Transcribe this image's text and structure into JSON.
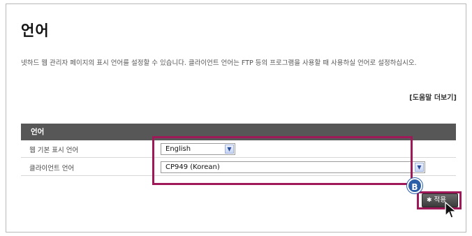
{
  "page": {
    "title": "언어",
    "description": "넷하드 웹 관리자 페이지의 표시 언어를 설정할 수 있습니다. 클라이언트 언어는 FTP 등의 프로그램을 사용할 때 사용하실 언어로 설정하십시오.",
    "help_link": "[도움말 더보기]"
  },
  "section": {
    "header": "언어",
    "rows": [
      {
        "label": "웹 기본 표시 언어",
        "value": "English"
      },
      {
        "label": "클라이언트 언어",
        "value": "CP949 (Korean)"
      }
    ]
  },
  "actions": {
    "apply_label": "적용"
  },
  "annotation": {
    "badge": "B",
    "color": "#9f1858"
  },
  "icons": {
    "dropdown": "chevron-down-icon",
    "apply": "gear-icon",
    "cursor": "pointer-cursor-icon"
  }
}
